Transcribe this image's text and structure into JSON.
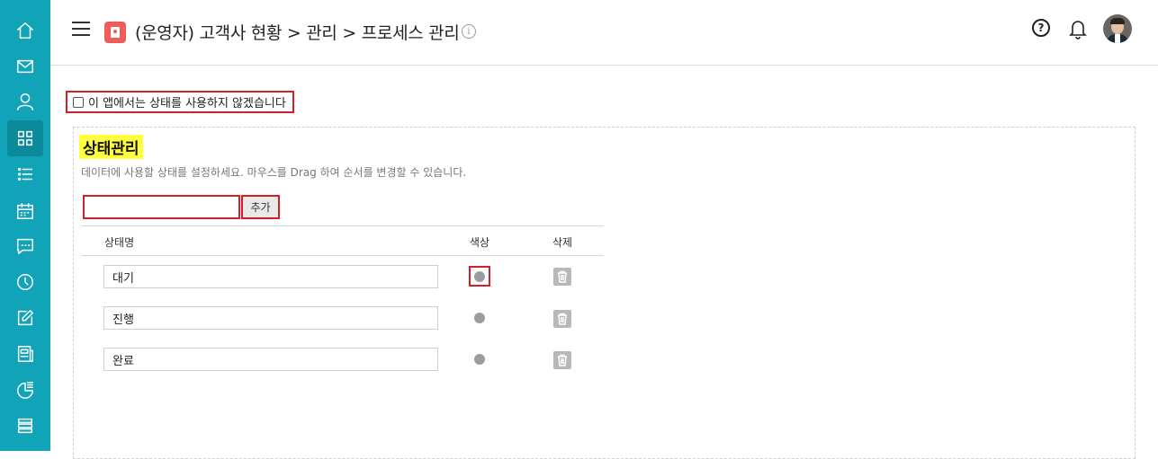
{
  "sidebar": {
    "items": [
      {
        "icon": "home-icon"
      },
      {
        "icon": "mail-icon"
      },
      {
        "icon": "user-icon"
      },
      {
        "icon": "grid-icon",
        "active": true
      },
      {
        "icon": "list-icon"
      },
      {
        "icon": "calendar-icon"
      },
      {
        "icon": "chat-icon"
      },
      {
        "icon": "clock-icon"
      },
      {
        "icon": "edit-icon"
      },
      {
        "icon": "board-icon"
      },
      {
        "icon": "chart-icon"
      },
      {
        "icon": "stack-icon"
      }
    ]
  },
  "header": {
    "title": "(운영자) 고객사 현황 > 관리 > 프로세스 관리",
    "info_icon": "i",
    "help_icon": "?"
  },
  "settings": {
    "disable_status_label": "이 앱에서는 상태를 사용하지 않겠습니다",
    "disable_status_checked": false
  },
  "status_section": {
    "title": "상태관리",
    "description": "데이터에 사용할 상태를 설정하세요. 마우스를 Drag 하여 순서를 변경할 수 있습니다.",
    "new_status_value": "",
    "add_label": "추가",
    "columns": {
      "name": "상태명",
      "color": "색상",
      "delete": "삭제"
    },
    "rows": [
      {
        "name": "대기",
        "color": "#9c9c9c"
      },
      {
        "name": "진행",
        "color": "#9c9c9c"
      },
      {
        "name": "완료",
        "color": "#9c9c9c"
      }
    ]
  },
  "colors": {
    "sidebar": "#11a3b8",
    "sidebar_active": "#0b8a9c",
    "highlight": "#ffff40",
    "annotation_red": "#d0202a",
    "app_icon": "#f05d5b"
  }
}
